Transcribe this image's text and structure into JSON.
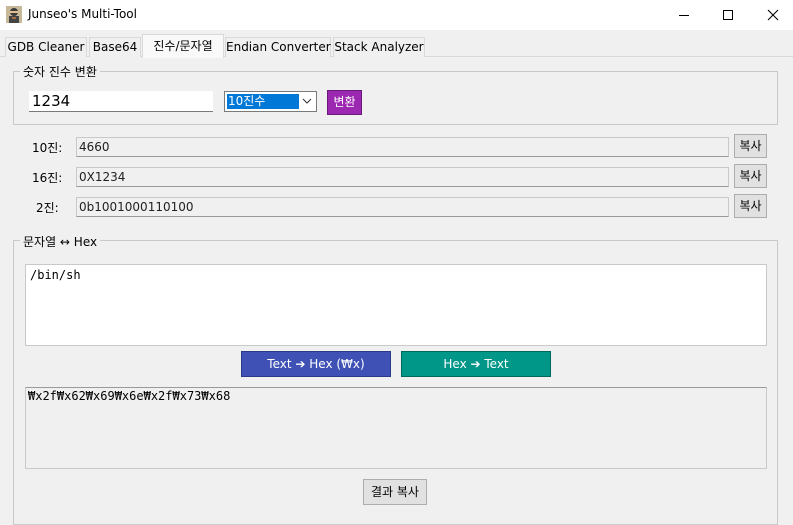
{
  "window": {
    "title": "Junseo's Multi-Tool",
    "icon": "ninja-app-icon",
    "controls": [
      "minimize-icon",
      "maximize-icon",
      "close-icon"
    ]
  },
  "tabs": [
    {
      "label": "GDB Cleaner",
      "active": false
    },
    {
      "label": "Base64",
      "active": false
    },
    {
      "label": "진수/문자열",
      "active": true
    },
    {
      "label": "Endian Converter",
      "active": false
    },
    {
      "label": "Stack Analyzer",
      "active": false
    }
  ],
  "base_converter": {
    "group_title": "숫자 진수 변환",
    "input_value": "1234",
    "base_select": {
      "selected": "10진수"
    },
    "convert_label": "변환",
    "convert_color": "#9c27b0",
    "results": [
      {
        "label": "10진:",
        "value": "4660",
        "copy_label": "복사"
      },
      {
        "label": "16진:",
        "value": "0X1234",
        "copy_label": "복사"
      },
      {
        "label": "2진:",
        "value": "0b1001000110100",
        "copy_label": "복사"
      }
    ]
  },
  "string_hex": {
    "group_title": "문자열 ↔ Hex",
    "input_text": "/bin/sh",
    "text_to_hex_label": "Text ➔ Hex (₩x)",
    "text_to_hex_color": "#3f51b5",
    "hex_to_text_label": "Hex ➔ Text",
    "hex_to_text_color": "#009688",
    "output_text": "₩x2f₩x62₩x69₩x6e₩x2f₩x73₩x68",
    "result_copy_label": "결과 복사"
  }
}
